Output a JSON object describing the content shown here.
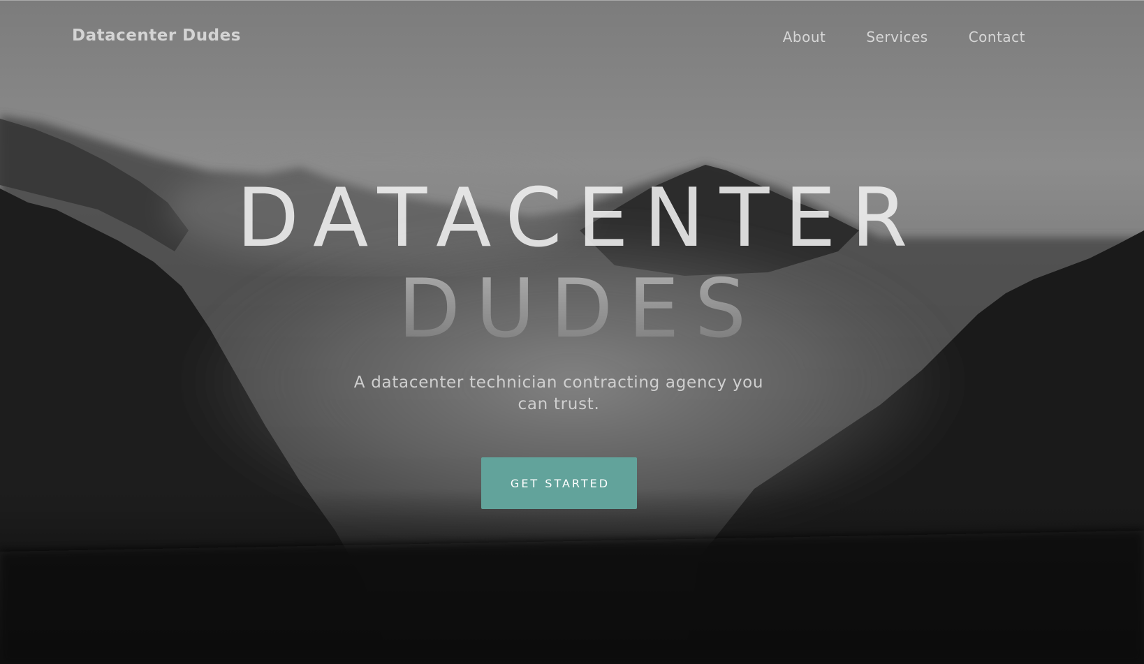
{
  "header": {
    "brand": "Datacenter Dudes",
    "nav": [
      {
        "label": "About"
      },
      {
        "label": "Services"
      },
      {
        "label": "Contact"
      }
    ]
  },
  "hero": {
    "title_line1": "DATACENTER",
    "title_line2": "DUDES",
    "subtitle": "A datacenter technician contracting agency you can trust.",
    "cta_label": "GET STARTED"
  },
  "background": {
    "description_icon": "misty-mountain-forest-image"
  },
  "colors": {
    "accent": "#62a39b",
    "nav_text": "#d6d6d6",
    "hero_text": "#f1f1f1"
  }
}
